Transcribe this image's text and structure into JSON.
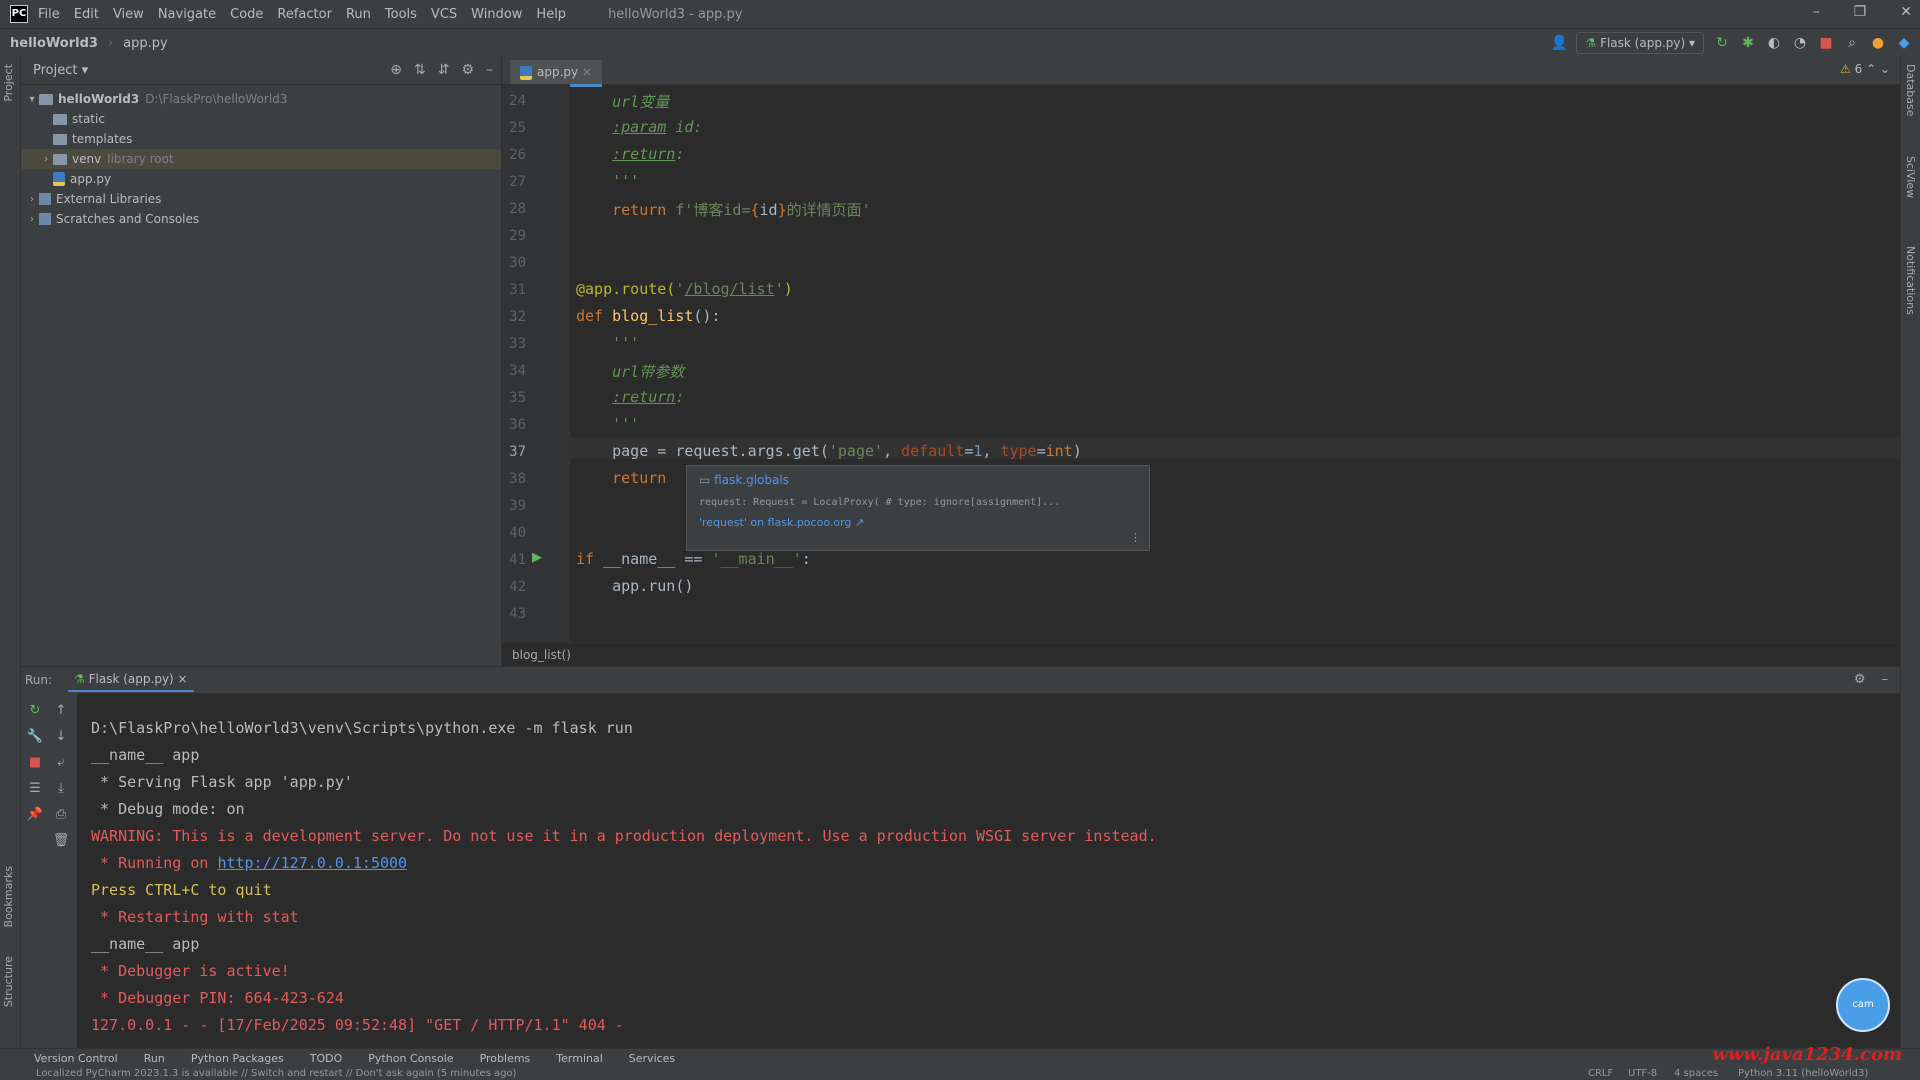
{
  "menubar": {
    "items": [
      "File",
      "Edit",
      "View",
      "Navigate",
      "Code",
      "Refactor",
      "Run",
      "Tools",
      "VCS",
      "Window",
      "Help"
    ],
    "window_title": "helloWorld3 - app.py"
  },
  "navbar": {
    "project": "helloWorld3",
    "file": "app.py",
    "run_config": "Flask (app.py)"
  },
  "project_panel": {
    "title": "Project",
    "tree": [
      {
        "label": "helloWorld3",
        "hint": "D:\\FlaskPro\\helloWorld3",
        "type": "folder",
        "expanded": true,
        "indent": 0
      },
      {
        "label": "static",
        "type": "folder",
        "indent": 1
      },
      {
        "label": "templates",
        "type": "folder",
        "indent": 1
      },
      {
        "label": "venv",
        "hint": "library root",
        "type": "folder",
        "indent": 1,
        "selected": true
      },
      {
        "label": "app.py",
        "type": "py",
        "indent": 1
      },
      {
        "label": "External Libraries",
        "type": "lib",
        "indent": 0
      },
      {
        "label": "Scratches and Consoles",
        "type": "lib",
        "indent": 0
      }
    ]
  },
  "editor": {
    "tab": "app.py",
    "warnings": "6",
    "current_line": "37",
    "line_numbers": [
      "24",
      "25",
      "26",
      "27",
      "28",
      "29",
      "30",
      "31",
      "32",
      "33",
      "34",
      "35",
      "36",
      "37",
      "38",
      "39",
      "40",
      "41",
      "42",
      "43"
    ],
    "breadcrumb": "blog_list()",
    "popup": {
      "module": "flask.globals",
      "signature": "request: Request = LocalProxy(  # type: ignore[assignment]...",
      "link": "'request' on flask.pocoo.org ↗"
    }
  },
  "run_panel": {
    "label": "Run:",
    "tab": "Flask (app.py)",
    "output": [
      {
        "text": "D:\\FlaskPro\\helloWorld3\\venv\\Scripts\\python.exe -m flask run",
        "style": "def"
      },
      {
        "text": "__name__ app",
        "style": "def"
      },
      {
        "text": " * Serving Flask app 'app.py'",
        "style": "def"
      },
      {
        "text": " * Debug mode: on",
        "style": "def"
      },
      {
        "text": "WARNING: This is a development server. Do not use it in a production deployment. Use a production WSGI server instead.",
        "style": "red"
      },
      {
        "text_prefix": " * Running on ",
        "link": "http://127.0.0.1:5000",
        "style": "red"
      },
      {
        "text": "Press CTRL+C to quit",
        "style": "yel"
      },
      {
        "text": " * Restarting with stat",
        "style": "red"
      },
      {
        "text": "__name__ app",
        "style": "def"
      },
      {
        "text": " * Debugger is active!",
        "style": "red"
      },
      {
        "text": " * Debugger PIN: 664-423-624",
        "style": "red"
      },
      {
        "text": "127.0.0.1 - - [17/Feb/2025 09:52:48] \"GET / HTTP/1.1\" 404 -",
        "style": "red"
      }
    ]
  },
  "bottom_tabs": [
    "Version Control",
    "Run",
    "Python Packages",
    "TODO",
    "Python Console",
    "Problems",
    "Terminal",
    "Services"
  ],
  "status": {
    "message": "Localized PyCharm 2023.1.3 is available // Switch and restart // Don't ask again (5 minutes ago)",
    "line_sep": "CRLF",
    "encoding": "UTF-8",
    "indent": "4 spaces",
    "interpreter": "Python 3.11 (helloWorld3)"
  },
  "watermark": "www.java1234.com",
  "side_labels": {
    "left_top": "Project",
    "left_mid": "Bookmarks",
    "left_bottom": "Structure",
    "right_1": "Database",
    "right_2": "SciView",
    "right_3": "Notifications"
  }
}
